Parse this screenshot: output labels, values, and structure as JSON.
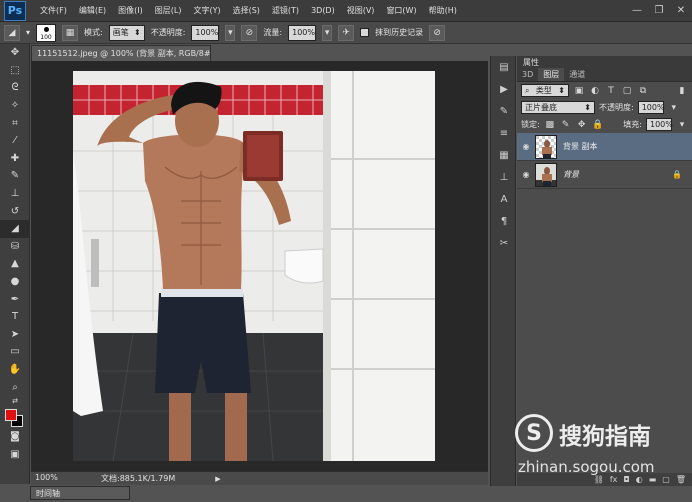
{
  "app": {
    "logo": "Ps"
  },
  "menu": [
    "文件(F)",
    "编辑(E)",
    "图像(I)",
    "图层(L)",
    "文字(Y)",
    "选择(S)",
    "滤镜(T)",
    "3D(D)",
    "视图(V)",
    "窗口(W)",
    "帮助(H)"
  ],
  "options": {
    "brush_size": "100",
    "mode_label": "模式:",
    "mode_value": "画笔",
    "opacity_label": "不透明度:",
    "opacity_value": "100%",
    "flow_label": "流量:",
    "flow_value": "100%",
    "erase_history_label": "抹到历史记录"
  },
  "document": {
    "tab_title": "11151512.jpeg @ 100% (背景 副本, RGB/8#) *",
    "zoom": "100%",
    "doc_info": "文档:885.1K/1.79M"
  },
  "timeline_label": "时间轴",
  "panel": {
    "properties_title": "属性",
    "tabs": [
      "3D",
      "图层",
      "通道"
    ],
    "active_tab": 1,
    "filter_kind": "类型",
    "blend_mode": "正片叠底",
    "opacity_label": "不透明度:",
    "opacity_value": "100%",
    "lock_label": "锁定:",
    "fill_label": "填充:",
    "fill_value": "100%",
    "layers": [
      {
        "name": "背景 副本",
        "selected": true,
        "locked": false
      },
      {
        "name": "背景",
        "selected": false,
        "locked": true
      }
    ]
  },
  "watermark": {
    "brand": "搜狗指南",
    "url": "zhinan.sogou.com",
    "logo_letter": "S"
  },
  "colors": {
    "foreground": "#e01010",
    "background": "#000000",
    "selection": "#5a6c82"
  }
}
